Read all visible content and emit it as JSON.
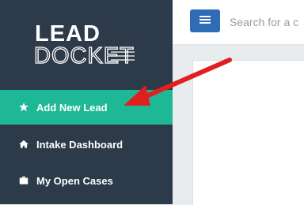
{
  "app": {
    "logo_top": "LEAD",
    "logo_bottom": "DOCKET"
  },
  "sidebar": {
    "items": [
      {
        "label": "Add New Lead",
        "icon": "star-icon",
        "active": true
      },
      {
        "label": "Intake Dashboard",
        "icon": "home-icon",
        "active": false
      },
      {
        "label": "My Open Cases",
        "icon": "briefcase-icon",
        "active": false
      }
    ]
  },
  "header": {
    "menu_icon": "hamburger-icon",
    "search_placeholder": "Search for a c"
  },
  "colors": {
    "sidebar_bg": "#2d3a4a",
    "active_item": "#1fb896",
    "menu_button": "#2e6cb5",
    "annotation_arrow": "#e02020"
  }
}
